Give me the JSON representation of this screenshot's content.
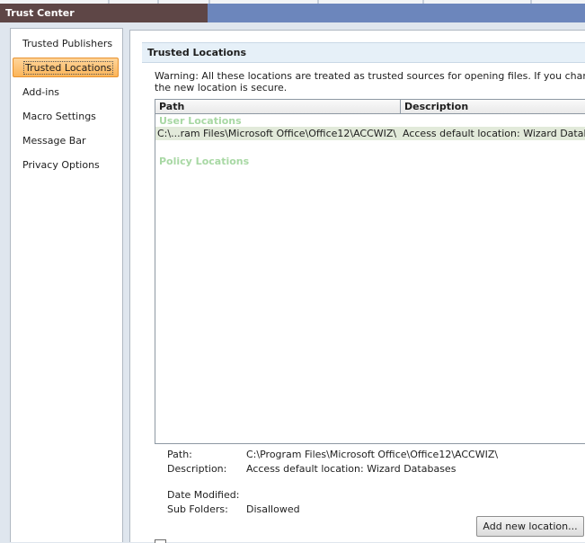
{
  "window": {
    "title": "Trust Center"
  },
  "nav": {
    "items": [
      {
        "label": "Trusted Publishers"
      },
      {
        "label": "Trusted Locations",
        "selected": true
      },
      {
        "label": "Add-ins"
      },
      {
        "label": "Macro Settings"
      },
      {
        "label": "Message Bar"
      },
      {
        "label": "Privacy Options"
      }
    ]
  },
  "main": {
    "section_title": "Trusted Locations",
    "warning_line1": "Warning: All these locations are treated as trusted sources for opening files.  If you change o",
    "warning_line2": "the new location is secure.",
    "columns": {
      "path": "Path",
      "description": "Description"
    },
    "user_locations_label": "User Locations",
    "policy_locations_label": "Policy Locations",
    "rows": [
      {
        "path": "C:\\...ram Files\\Microsoft Office\\Office12\\ACCWIZ\\",
        "description": "Access default location: Wizard Databas"
      }
    ],
    "details": {
      "path_label": "Path:",
      "path_value": "C:\\Program Files\\Microsoft Office\\Office12\\ACCWIZ\\",
      "description_label": "Description:",
      "description_value": "Access default location: Wizard Databases",
      "date_modified_label": "Date Modified:",
      "date_modified_value": "",
      "sub_folders_label": "Sub Folders:",
      "sub_folders_value": "Disallowed"
    },
    "add_button_label": "Add new location..."
  }
}
